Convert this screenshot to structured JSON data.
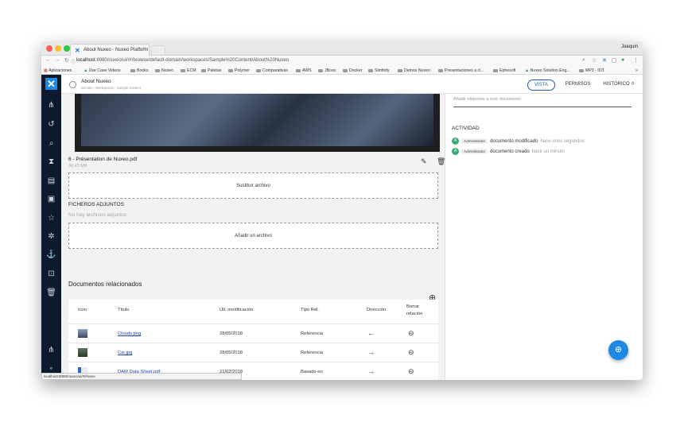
{
  "browser": {
    "tab_title": "About Nuxeo - Nuxeo Platform",
    "tab_close": "×",
    "user": "Joaquin",
    "url_host": "localhost",
    "url_rest": ":8080/nuxeo/ui/#!/browse/default-domain/workspaces/Sample%20Content/About%20Nuxeo",
    "bookmarks": [
      "Aplicaciones",
      "Use Case Videos",
      "Books",
      "Nuxeo",
      "ECM",
      "Paletas",
      "Polymer",
      "Comparativas",
      "AWS",
      "JBoss",
      "Docker",
      "Simfiofy",
      "Demos Nuxeo",
      "Presentaciones a cl...",
      "Ephesoft",
      "Nuxeo Solution Eng...",
      "MP3 - ID3"
    ],
    "status_url": "localhost:8080/nuxeo/ui/#!/home"
  },
  "header": {
    "title": "About Nuxeo",
    "breadcrumb": "Domain › Workspaces › Sample Content",
    "tabs": [
      "VISTA",
      "PERMISOS",
      "HISTÓRICO"
    ]
  },
  "main": {
    "file_name": "6 - Présentation de Nuxeo.pdf",
    "file_size": "30.43 MB",
    "replace_label": "Sustituir archivo",
    "attachments_heading": "FICHEROS ADJUNTOS",
    "no_attachments": "No hay archivos adjuntos",
    "add_file_label": "Añadir un archivo",
    "related_heading": "Documentos relacionados",
    "table": {
      "headers": [
        "Icon",
        "Título",
        "Últ. modificación",
        "Tipo Rel.",
        "Dirección",
        "Borrar relación"
      ],
      "rows": [
        {
          "title": "Clouds.png",
          "modified": "28/05/2018",
          "type": "Referencia",
          "direction": "←"
        },
        {
          "title": "Car.jpg",
          "modified": "28/05/2018",
          "type": "Referencia",
          "direction": "→"
        },
        {
          "title": "DAM Data Sheet.pdf",
          "modified": "21/02/2018",
          "type": "Basado en",
          "direction": "→"
        }
      ]
    }
  },
  "right": {
    "tags_placeholder": "Añadir etiquetas a este documento",
    "activity_heading": "ACTIVIDAD",
    "activity": [
      {
        "avatar": "A",
        "user": "Administrator",
        "action": "documento modificado",
        "when": "hace unos segundos"
      },
      {
        "avatar": "A",
        "user": "Administrator",
        "action": "documento creado",
        "when": "hace un minuto"
      }
    ]
  },
  "colors": {
    "accent": "#1e88e5",
    "sidebar": "#0d1a2e",
    "link": "#1a3fa8"
  }
}
